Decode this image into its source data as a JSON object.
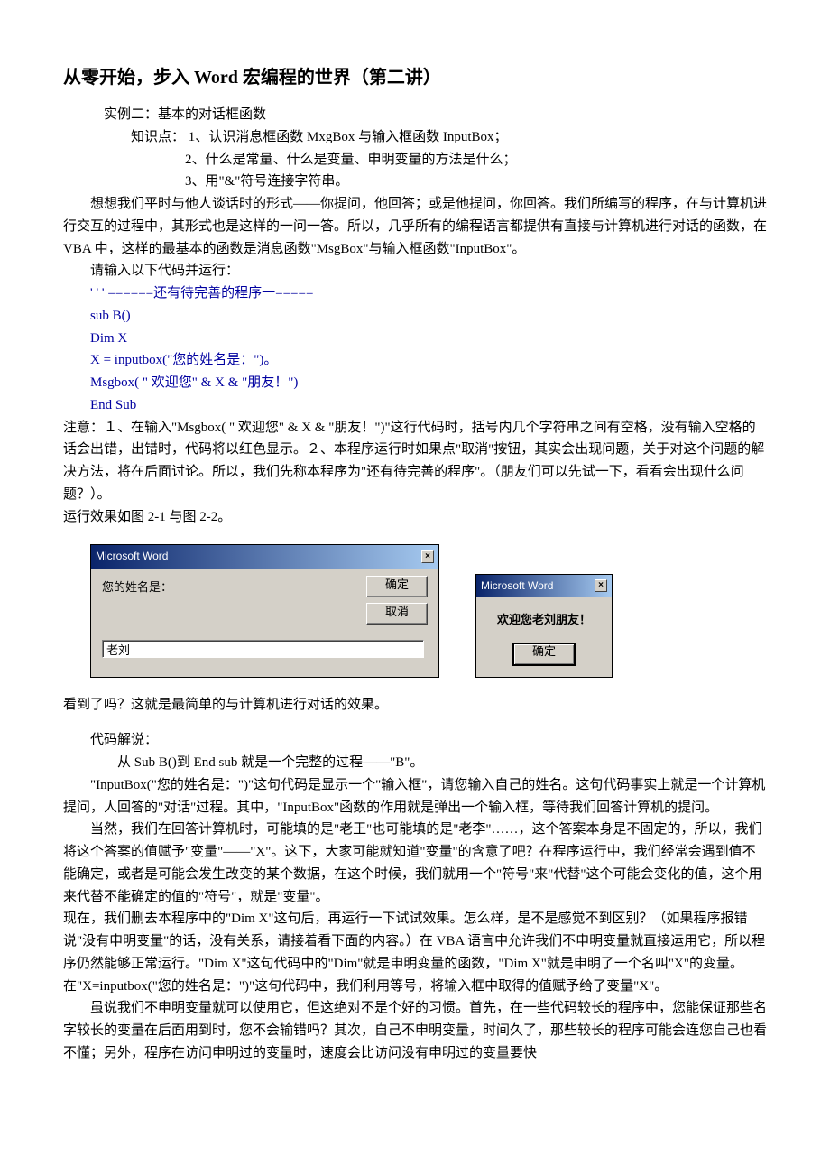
{
  "title": "从零开始，步入 Word 宏编程的世界（第二讲）",
  "example_label": "实例二：基本的对话框函数",
  "knowledge_label": "知识点：",
  "knowledge_points": [
    "1、认识消息框函数 MxgBox 与输入框函数 InputBox；",
    "2、什么是常量、什么是变量、申明变量的方法是什么；",
    "3、用\"&\"符号连接字符串。"
  ],
  "intro_para": "想想我们平时与他人谈话时的形式——你提问，他回答；或是他提问，你回答。我们所编写的程序，在与计算机进行交互的过程中，其形式也是这样的一问一答。所以，几乎所有的编程语言都提供有直接与计算机进行对话的函数，在 VBA 中，这样的最基本的函数是消息函数\"MsgBox\"与输入框函数\"InputBox\"。",
  "code_prompt": "请输入以下代码并运行：",
  "code_lines": [
    "' ' ' ======还有待完善的程序一=====",
    "sub B()",
    "Dim X",
    "X = inputbox(\"您的姓名是：\")。",
    "Msgbox( \" 欢迎您\" & X & \"朋友！\")",
    "End Sub"
  ],
  "note_para": "注意：１、在输入\"Msgbox( \" 欢迎您\" & X & \"朋友！\")\"这行代码时，括号内几个字符串之间有空格，没有输入空格的话会出错，出错时，代码将以红色显示。２、本程序运行时如果点\"取消\"按钮，其实会出现问题，关于对这个问题的解决方法，将在后面讨论。所以，我们先称本程序为\"还有待完善的程序\"。（朋友们可以先试一下，看看会出现什么问题？）。",
  "runeffect_label": "运行效果如图 2-1 与图 2-2。",
  "dialog1": {
    "title": "Microsoft Word",
    "prompt": "您的姓名是：",
    "ok": "确定",
    "cancel": "取消",
    "input_value": "老刘"
  },
  "dialog2": {
    "title": "Microsoft Word",
    "message": "欢迎您老刘朋友！",
    "ok": "确定"
  },
  "after_dialog": "看到了吗？这就是最简单的与计算机进行对话的效果。",
  "explain_header": "代码解说：",
  "explain_p1": "从 Sub B()到 End sub 就是一个完整的过程——\"B\"。",
  "explain_p2": "\"InputBox(\"您的姓名是：\")\"这句代码是显示一个\"输入框\"，请您输入自己的姓名。这句代码事实上就是一个计算机提问，人回答的\"对话\"过程。其中，\"InputBox\"函数的作用就是弹出一个输入框，等待我们回答计算机的提问。",
  "explain_p3": "当然，我们在回答计算机时，可能填的是\"老王\"也可能填的是\"老李\"……，这个答案本身是不固定的，所以，我们将这个答案的值赋予\"变量\"——\"X\"。这下，大家可能就知道\"变量\"的含意了吧？在程序运行中，我们经常会遇到值不能确定，或者是可能会发生改变的某个数据，在这个时候，我们就用一个\"符号\"来\"代替\"这个可能会变化的值，这个用来代替不能确定的值的\"符号\"，就是\"变量\"。",
  "explain_p4": "现在，我们删去本程序中的\"Dim X\"这句后，再运行一下试试效果。怎么样，是不是感觉不到区别？（如果程序报错说\"没有申明变量\"的话，没有关系，请接着看下面的内容。）在 VBA 语言中允许我们不申明变量就直接运用它，所以程序仍然能够正常运行。\"Dim X\"这句代码中的\"Dim\"就是申明变量的函数，\"Dim X\"就是申明了一个名叫\"X\"的变量。在\"X=inputbox(\"您的姓名是：\")\"这句代码中，我们利用等号，将输入框中取得的值赋予给了变量\"X\"。",
  "explain_p5": "虽说我们不申明变量就可以使用它，但这绝对不是个好的习惯。首先，在一些代码较长的程序中，您能保证那些名字较长的变量在后面用到时，您不会输错吗？其次，自己不申明变量，时间久了，那些较长的程序可能会连您自己也看不懂；另外，程序在访问申明过的变量时，速度会比访问没有申明过的变量要快"
}
